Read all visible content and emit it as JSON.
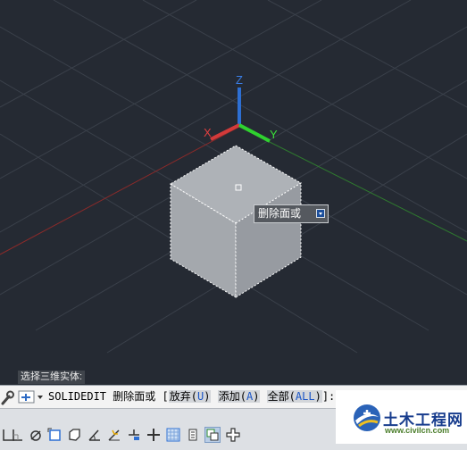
{
  "viewport": {
    "axis_labels": {
      "x": "X",
      "y": "Y",
      "z": "Z"
    },
    "tooltip_text": "删除面或",
    "colors": {
      "background": "#252a33",
      "cube_top": "#aeb2b7",
      "cube_left": "#a4a8ad",
      "cube_right": "#979ba1"
    }
  },
  "history_text": "选择三维实体:",
  "command": {
    "name": "SOLIDEDIT",
    "prompt": "删除面或",
    "bracket_open": "[",
    "options": [
      {
        "label": "放弃",
        "key": "U"
      },
      {
        "label": "添加",
        "key": "A"
      },
      {
        "label": "全部",
        "key": "ALL"
      }
    ],
    "bracket_close": "]:"
  },
  "status_toolbar": [
    {
      "icon": "model-space-icon",
      "active": false
    },
    {
      "icon": "grid-icon",
      "active": false
    },
    {
      "icon": "snap-mode-icon",
      "active": false
    },
    {
      "icon": "object-snap-tracking-icon",
      "active": false
    },
    {
      "icon": "3d-object-snap-icon",
      "active": false
    },
    {
      "icon": "object-snap-icon",
      "active": false
    },
    {
      "icon": "dynamic-ucs-icon",
      "active": false
    },
    {
      "icon": "dynamic-input-icon",
      "active": false
    },
    {
      "icon": "lineweight-icon",
      "active": false
    },
    {
      "icon": "transparency-icon",
      "active": false
    },
    {
      "icon": "quick-properties-icon",
      "active": false
    },
    {
      "icon": "selection-cycling-icon",
      "active": true
    },
    {
      "icon": "annotation-monitor-icon",
      "active": false
    },
    {
      "icon": "isolate-objects-icon",
      "active": false
    },
    {
      "icon": "customization-icon",
      "active": false
    }
  ],
  "watermark": {
    "name": "土木工程网",
    "url": "www.civilcn.com"
  }
}
